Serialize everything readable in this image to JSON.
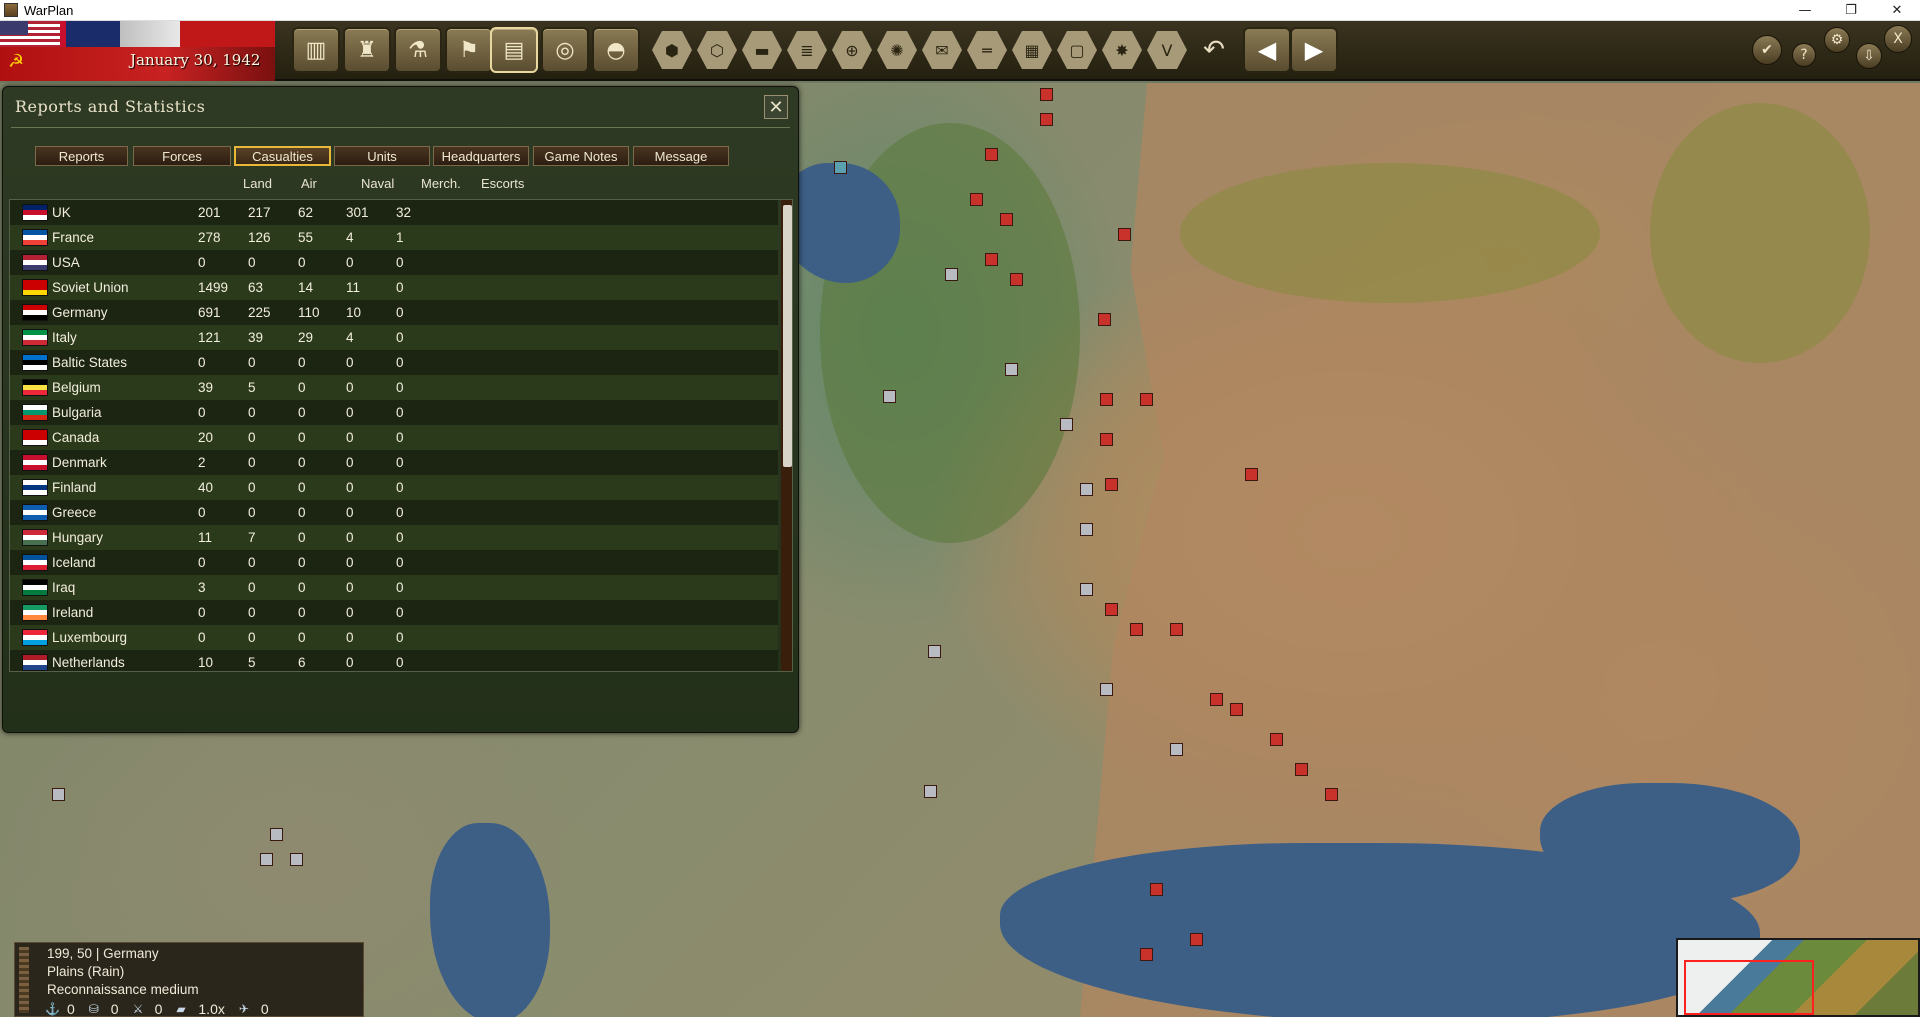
{
  "window": {
    "title": "WarPlan",
    "controls": [
      "—",
      "❐",
      "✕"
    ]
  },
  "topbar": {
    "date": "January 30, 1942",
    "main_buttons": [
      "factory-icon",
      "production-icon",
      "research-icon",
      "flag-icon",
      "reports-icon",
      "binoculars-icon",
      "helmet-icon"
    ],
    "hex_buttons": [
      "hex-grid-icon",
      "hexes-icon",
      "supply-icon",
      "stack-icon",
      "target-icon",
      "sun-icon",
      "mail-icon",
      "road-icon",
      "grid-icon",
      "frame-icon",
      "explosion-icon",
      "v-icon"
    ],
    "undo_icon": "↶",
    "right_buttons": [
      "check-icon",
      "help-icon",
      "settings-icon",
      "save-icon",
      "exit-icon"
    ],
    "help_label": "?",
    "exit_label": "X"
  },
  "panel": {
    "title": "Reports and Statistics",
    "close": "✕",
    "tabs": [
      "Reports",
      "Forces",
      "Casualties",
      "Units",
      "Headquarters",
      "Game Notes",
      "Message"
    ],
    "selected_tab": "Casualties",
    "columns": [
      "Land",
      "Air",
      "Naval",
      "Merch.",
      "Escorts"
    ],
    "rows": [
      {
        "name": "UK",
        "land": "201",
        "air": "217",
        "naval": "62",
        "merch": "301",
        "escorts": "32"
      },
      {
        "name": "France",
        "land": "278",
        "air": "126",
        "naval": "55",
        "merch": "4",
        "escorts": "1"
      },
      {
        "name": "USA",
        "land": "0",
        "air": "0",
        "naval": "0",
        "merch": "0",
        "escorts": "0"
      },
      {
        "name": "Soviet Union",
        "land": "1499",
        "air": "63",
        "naval": "14",
        "merch": "11",
        "escorts": "0"
      },
      {
        "name": "Germany",
        "land": "691",
        "air": "225",
        "naval": "110",
        "merch": "10",
        "escorts": "0"
      },
      {
        "name": "Italy",
        "land": "121",
        "air": "39",
        "naval": "29",
        "merch": "4",
        "escorts": "0"
      },
      {
        "name": "Baltic States",
        "land": "0",
        "air": "0",
        "naval": "0",
        "merch": "0",
        "escorts": "0"
      },
      {
        "name": "Belgium",
        "land": "39",
        "air": "5",
        "naval": "0",
        "merch": "0",
        "escorts": "0"
      },
      {
        "name": "Bulgaria",
        "land": "0",
        "air": "0",
        "naval": "0",
        "merch": "0",
        "escorts": "0"
      },
      {
        "name": "Canada",
        "land": "20",
        "air": "0",
        "naval": "0",
        "merch": "0",
        "escorts": "0"
      },
      {
        "name": "Denmark",
        "land": "2",
        "air": "0",
        "naval": "0",
        "merch": "0",
        "escorts": "0"
      },
      {
        "name": "Finland",
        "land": "40",
        "air": "0",
        "naval": "0",
        "merch": "0",
        "escorts": "0"
      },
      {
        "name": "Greece",
        "land": "0",
        "air": "0",
        "naval": "0",
        "merch": "0",
        "escorts": "0"
      },
      {
        "name": "Hungary",
        "land": "11",
        "air": "7",
        "naval": "0",
        "merch": "0",
        "escorts": "0"
      },
      {
        "name": "Iceland",
        "land": "0",
        "air": "0",
        "naval": "0",
        "merch": "0",
        "escorts": "0"
      },
      {
        "name": "Iraq",
        "land": "3",
        "air": "0",
        "naval": "0",
        "merch": "0",
        "escorts": "0"
      },
      {
        "name": "Ireland",
        "land": "0",
        "air": "0",
        "naval": "0",
        "merch": "0",
        "escorts": "0"
      },
      {
        "name": "Luxembourg",
        "land": "0",
        "air": "0",
        "naval": "0",
        "merch": "0",
        "escorts": "0"
      },
      {
        "name": "Netherlands",
        "land": "10",
        "air": "5",
        "naval": "6",
        "merch": "0",
        "escorts": "0"
      }
    ]
  },
  "flag_colors": {
    "UK": [
      "#012169",
      "#c8102e",
      "#ffffff"
    ],
    "France": [
      "#0055a4",
      "#ffffff",
      "#ef4135"
    ],
    "USA": [
      "#b22234",
      "#ffffff",
      "#3c3b6e"
    ],
    "Soviet Union": [
      "#cc0000",
      "#cc0000",
      "#ffd700"
    ],
    "Germany": [
      "#cc0000",
      "#ffffff",
      "#000000"
    ],
    "Italy": [
      "#009246",
      "#ffffff",
      "#ce2b37"
    ],
    "Baltic States": [
      "#0072ce",
      "#000000",
      "#ffffff"
    ],
    "Belgium": [
      "#000000",
      "#fae042",
      "#ed2939"
    ],
    "Bulgaria": [
      "#ffffff",
      "#00966e",
      "#d62612"
    ],
    "Canada": [
      "#cc0000",
      "#cc0000",
      "#ffffff"
    ],
    "Denmark": [
      "#c8102e",
      "#ffffff",
      "#c8102e"
    ],
    "Finland": [
      "#ffffff",
      "#003580",
      "#ffffff"
    ],
    "Greece": [
      "#0d5eaf",
      "#ffffff",
      "#0d5eaf"
    ],
    "Hungary": [
      "#ce2939",
      "#ffffff",
      "#477050"
    ],
    "Iceland": [
      "#02529c",
      "#ffffff",
      "#dc1e35"
    ],
    "Iraq": [
      "#000000",
      "#ffffff",
      "#007a3d"
    ],
    "Ireland": [
      "#169b62",
      "#ffffff",
      "#ff883e"
    ],
    "Luxembourg": [
      "#ed2939",
      "#ffffff",
      "#00a1de"
    ],
    "Netherlands": [
      "#ae1c28",
      "#ffffff",
      "#21468b"
    ]
  },
  "info": {
    "coords": "199, 50",
    "country": "Germany",
    "terrain": "Plains (Rain)",
    "recon": "Reconnaissance medium",
    "stats": [
      {
        "icon": "anchor-icon",
        "glyph": "⚓",
        "value": "0"
      },
      {
        "icon": "supply-icon",
        "glyph": "⛁",
        "value": "0"
      },
      {
        "icon": "artillery-icon",
        "glyph": "⚔",
        "value": "0"
      },
      {
        "icon": "fortification-icon",
        "glyph": "▰",
        "value": "1.0x"
      },
      {
        "icon": "aircraft-icon",
        "glyph": "✈",
        "value": "0"
      }
    ]
  }
}
